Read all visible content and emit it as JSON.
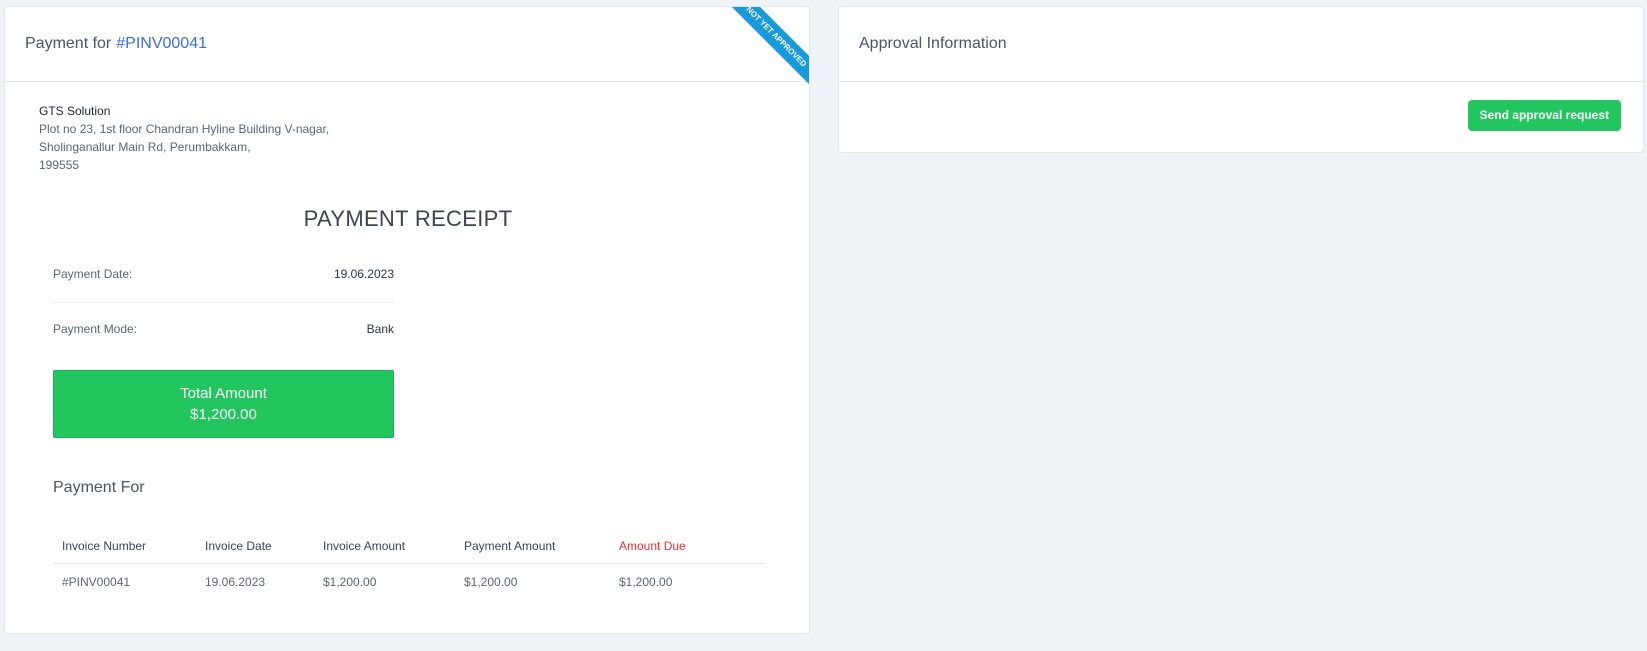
{
  "payment": {
    "title_prefix": "Payment for",
    "invoice_ref": "#PINV00041",
    "ribbon": "NOT YET APPROVED"
  },
  "company": {
    "name": "GTS Solution",
    "address_line1": "Plot no 23, 1st floor Chandran Hyline Building V-nagar,",
    "address_line2": "Sholinganallur Main Rd, Perumbakkam,",
    "postal": "199555"
  },
  "receipt": {
    "title": "PAYMENT RECEIPT",
    "date_label": "Payment Date:",
    "date_value": "19.06.2023",
    "mode_label": "Payment Mode:",
    "mode_value": "Bank",
    "total_label": "Total Amount",
    "total_value": "$1,200.00"
  },
  "payment_for": {
    "heading": "Payment For",
    "columns": [
      "Invoice Number",
      "Invoice Date",
      "Invoice Amount",
      "Payment Amount",
      "Amount Due"
    ],
    "rows": [
      [
        "#PINV00041",
        "19.06.2023",
        "$1,200.00",
        "$1,200.00",
        "$1,200.00"
      ]
    ]
  },
  "approval": {
    "title": "Approval Information",
    "button_label": "Send approval request"
  },
  "colors": {
    "accent_green": "#22c55e",
    "link_blue": "#3b6fd8",
    "ribbon_blue": "#1a9ad9",
    "due_red": "#e03131"
  }
}
